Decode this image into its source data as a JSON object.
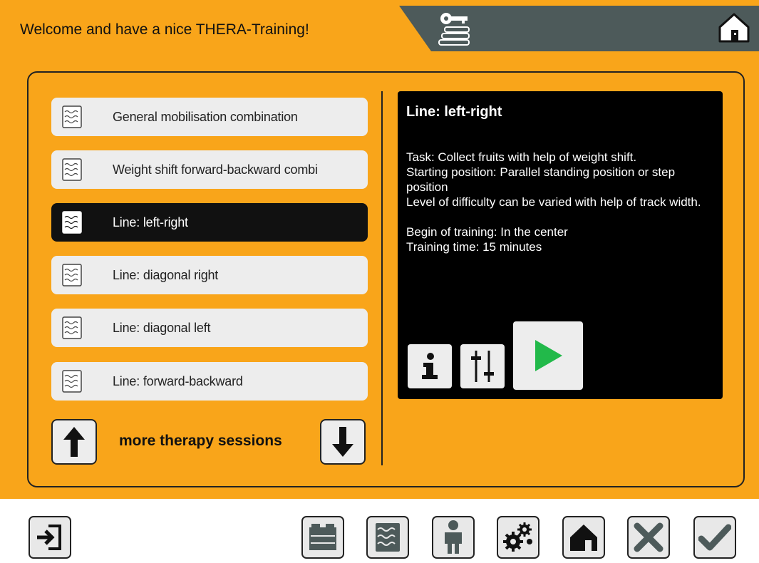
{
  "header": {
    "title": "Welcome and have a nice THERA-Training!",
    "key_icon": "key-levels-icon",
    "home_icon": "home-icon"
  },
  "colors": {
    "accent": "#f9a51a",
    "dark_tab": "#4d5a5a",
    "selected": "#111111",
    "play": "#22b94a"
  },
  "sessions": {
    "items": [
      {
        "label": "General mobilisation combination"
      },
      {
        "label": "Weight shift forward-backward combi"
      },
      {
        "label": "Line: left-right",
        "selected": true
      },
      {
        "label": "Line: diagonal right"
      },
      {
        "label": "Line: diagonal left"
      },
      {
        "label": "Line: forward-backward"
      }
    ],
    "more_label": "more therapy sessions"
  },
  "detail": {
    "title": "Line: left-right",
    "body": "Task: Collect fruits with help of weight shift.\nStarting position: Parallel standing position or step position\nLevel of difficulty can be varied with help of track width.\n\nBegin of training: In the center\nTraining time: 15 minutes"
  },
  "toolbar": {
    "icons": [
      "logout-icon",
      "training-programs-icon",
      "therapy-sessions-icon",
      "patient-icon",
      "settings-icon",
      "home-icon",
      "cancel-icon",
      "confirm-icon"
    ]
  }
}
